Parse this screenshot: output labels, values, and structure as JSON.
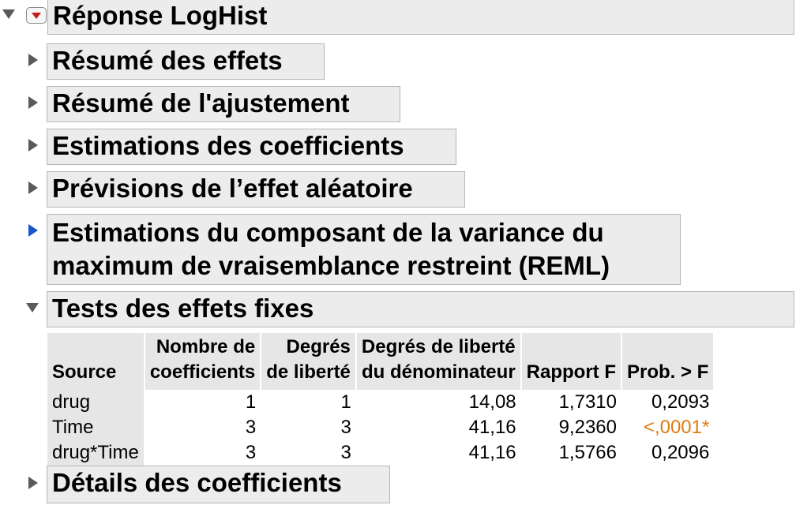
{
  "report": {
    "title": "Réponse LogHist",
    "sections": {
      "effect_summary": "Résumé des effets",
      "fit_summary": "Résumé de l'ajustement",
      "parameter_estimates": "Estimations des coefficients",
      "random_effect_predictions": "Prévisions de l’effet aléatoire",
      "reml_line1": "Estimations du composant de la variance du",
      "reml_line2": "maximum de vraisemblance restreint (REML)",
      "fixed_effects_tests": "Tests des effets fixes",
      "coefficient_details": "Détails des coefficients"
    }
  },
  "fixed_effects_table": {
    "columns": {
      "source": "Source",
      "nparm_1": "Nombre de",
      "nparm_2": "coefficients",
      "df_1": "Degrés",
      "df_2": "de liberté",
      "dfden_1": "Degrés de liberté",
      "dfden_2": "du dénominateur",
      "f_ratio": "Rapport F",
      "prob": "Prob. > F"
    },
    "rows": [
      {
        "source": "drug",
        "nparm": "1",
        "df": "1",
        "dfden": "14,08",
        "f_ratio": "1,7310",
        "prob": "0,2093"
      },
      {
        "source": "Time",
        "nparm": "3",
        "df": "3",
        "dfden": "41,16",
        "f_ratio": "9,2360",
        "prob": "<,0001*"
      },
      {
        "source": "drug*Time",
        "nparm": "3",
        "df": "3",
        "dfden": "41,16",
        "f_ratio": "1,5766",
        "prob": "0,2096"
      }
    ]
  },
  "colors": {
    "significant_p": "#e07b10",
    "active_disclosure": "#1458c8",
    "menu_caret": "#c41a1a"
  }
}
